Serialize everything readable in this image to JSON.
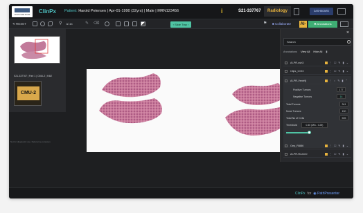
{
  "header": {
    "logo_text": "SUNNYSIDE MUSE",
    "app_name": "ClinPx",
    "patient_label": "Patient:",
    "patient_info": "Harold Petersen | Apr-01-1990 (32yrs) | Male | MRN123456",
    "case_id": "S21-337767",
    "department": "Radiology",
    "dashboard_label": "DASHBOARD"
  },
  "toolbar": {
    "reset_label": "RESET",
    "zoom_label": "1x",
    "slide_tray_label": "Slide Tray",
    "collaborate_label": "Collaborate",
    "ai_label": "AI-",
    "annotations_label": "Annotations"
  },
  "tray": {
    "slide_label": "S21-337767 | Part 1 | CMU-2 | H&E",
    "sticker_text": "CMU-2",
    "watermark": "Not for diagnostic use. Reference purposes"
  },
  "panel": {
    "search_placeholder": "Search",
    "tabs": [
      "Annotations",
      "View All",
      "Hide All"
    ],
    "rows": [
      {
        "name": "AI-PR-ssh3"
      },
      {
        "name": "Clips_COI3"
      },
      {
        "name": "AI-PR-Ventr9j"
      }
    ],
    "details": {
      "positive_label": "Positive Tumors",
      "positive_value": "177",
      "negative_label": "Negative Tumors",
      "negative_value": "14",
      "total_tumors_label": "Total Tumors",
      "total_tumors_value": "341",
      "none_tumors_label": "None Tumors",
      "none_tumors_value": "150",
      "total_cells_label": "Total No of Cells",
      "total_cells_value": "505",
      "threshold_label": "Threshold",
      "threshold_value": "0.40 (Min - 0.25)",
      "threshold_level": 0.85
    },
    "bottom_rows": [
      {
        "name": "Oep_Ri886"
      },
      {
        "name": "AI-PR-Ri-elm0"
      }
    ]
  },
  "footer": {
    "brand": "ClinPx",
    "for_label": "for",
    "partner": "PathPresenter"
  },
  "colors": {
    "accent_teal": "#4fc3c3",
    "accent_yellow": "#e8b33d",
    "annotations_green": "#3fae74",
    "dashboard_blue": "#2a3c6b"
  }
}
